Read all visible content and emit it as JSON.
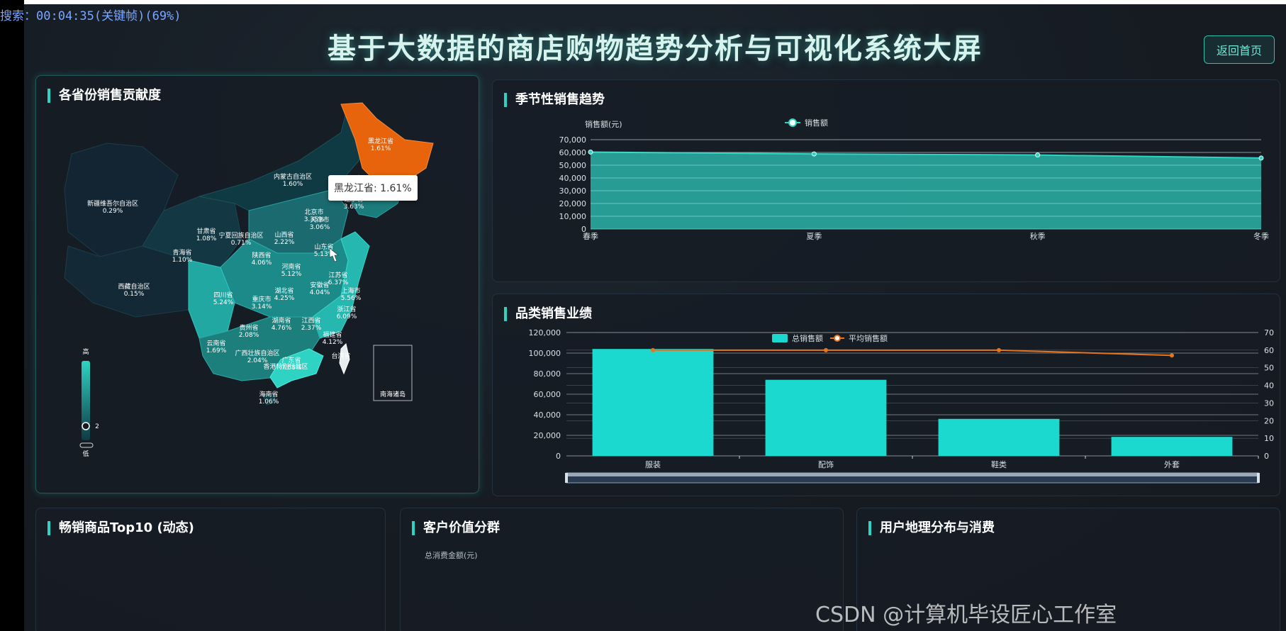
{
  "osd": {
    "text": "搜索：00:04:35(关键帧)(69%)"
  },
  "header": {
    "title": "基于大数据的商店购物趋势分析与可视化系统大屏",
    "back_button": "返回首页"
  },
  "map_panel": {
    "title": "各省份销售贡献度",
    "tooltip": "黑龙江省: 1.61%",
    "legend_high": "高",
    "legend_low": "低",
    "legend_value": "2",
    "inset_label": "南海诸岛",
    "provinces": [
      {
        "name": "黑龙江省",
        "value": "1.61%"
      },
      {
        "name": "内蒙古自治区",
        "value": "1.60%"
      },
      {
        "name": "新疆维吾尔自治区",
        "value": "0.29%"
      },
      {
        "name": "辽宁省",
        "value": "3.63%"
      },
      {
        "name": "北京市",
        "value": "3.35%"
      },
      {
        "name": "天津市",
        "value": "3.06%"
      },
      {
        "name": "甘肃省",
        "value": "1.08%"
      },
      {
        "name": "宁夏回族自治区",
        "value": "0.71%"
      },
      {
        "name": "山西省",
        "value": "2.22%"
      },
      {
        "name": "山东省",
        "value": "5.13%"
      },
      {
        "name": "青海省",
        "value": "1.10%"
      },
      {
        "name": "陕西省",
        "value": "4.06%"
      },
      {
        "name": "河南省",
        "value": "5.12%"
      },
      {
        "name": "江苏省",
        "value": "6.37%"
      },
      {
        "name": "西藏自治区",
        "value": "0.15%"
      },
      {
        "name": "四川省",
        "value": "5.24%"
      },
      {
        "name": "湖北省",
        "value": "4.25%"
      },
      {
        "name": "安徽省",
        "value": "4.04%"
      },
      {
        "name": "上海市",
        "value": "5.56%"
      },
      {
        "name": "重庆市",
        "value": "3.14%"
      },
      {
        "name": "浙江省",
        "value": "6.09%"
      },
      {
        "name": "湖南省",
        "value": "4.76%"
      },
      {
        "name": "江西省",
        "value": "2.37%"
      },
      {
        "name": "贵州省",
        "value": "2.08%"
      },
      {
        "name": "福建省",
        "value": "4.12%"
      },
      {
        "name": "云南省",
        "value": "1.69%"
      },
      {
        "name": "广西壮族自治区",
        "value": "2.04%"
      },
      {
        "name": "广东省",
        "value": "7.68%"
      },
      {
        "name": "海南省",
        "value": "1.06%"
      },
      {
        "name": "台湾省",
        "value": ""
      }
    ],
    "extra_label": "香港特别行政区",
    "colors": {
      "highlight": "#e8640c",
      "high": "#2fd3c3",
      "low": "#0f3a44"
    }
  },
  "seasonal_panel": {
    "title": "季节性销售趋势",
    "chart_data": {
      "type": "area",
      "x": [
        "春季",
        "夏季",
        "秋季",
        "冬季"
      ],
      "series": [
        {
          "name": "销售额",
          "values": [
            60300,
            58800,
            58000,
            55600
          ]
        }
      ],
      "ylabel": "销售额(元)",
      "ylim": [
        0,
        70000
      ],
      "yticks": [
        "0",
        "10,000",
        "20,000",
        "30,000",
        "40,000",
        "50,000",
        "60,000",
        "70,000"
      ],
      "legend": "top-center",
      "color": "#2fd3c3"
    }
  },
  "category_panel": {
    "title": "品类销售业绩",
    "chart_data": {
      "type": "bar",
      "categories": [
        "服装",
        "配饰",
        "鞋类",
        "外套"
      ],
      "series": [
        {
          "name": "总销售额",
          "values": [
            104000,
            74000,
            36000,
            18500
          ],
          "axis": "left"
        },
        {
          "name": "平均销售额",
          "values": [
            60,
            60,
            60,
            57
          ],
          "axis": "right",
          "type": "line"
        }
      ],
      "ylim": [
        0,
        120000
      ],
      "y2lim": [
        0,
        70
      ],
      "yticks": [
        "0",
        "20,000",
        "40,000",
        "60,000",
        "80,000",
        "100,000",
        "120,000"
      ],
      "y2ticks": [
        "0",
        "10",
        "20",
        "30",
        "40",
        "50",
        "60",
        "70"
      ],
      "legend": "top-center",
      "colors": {
        "bar": "#1bd9cf",
        "line": "#e8741c"
      }
    }
  },
  "bottom_panels": {
    "top10_title": "畅销商品Top10 (动态)",
    "customer_title": "客户价值分群",
    "customer_sub": "总消费金额(元)",
    "third_title": "用户地理分布与消费"
  },
  "watermark": "CSDN @计算机毕设匠心工作室"
}
